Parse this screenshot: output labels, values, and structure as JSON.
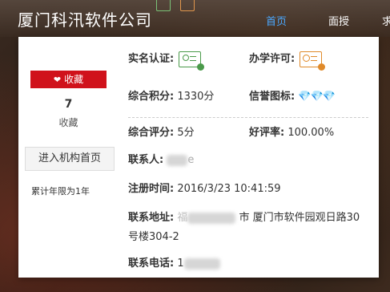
{
  "header": {
    "company_name": "厦门科汛软件公司",
    "nav": [
      {
        "label": "首页",
        "active": true
      },
      {
        "label": "面授",
        "active": false
      },
      {
        "label": "求",
        "active": false
      }
    ]
  },
  "sidebar": {
    "favorite_button": "收藏",
    "favorite_count": "7",
    "favorite_label": "收藏",
    "enter_button": "进入机构首页",
    "yearly_limit": "累计年限为1年"
  },
  "info": {
    "real_name_label": "实名认证:",
    "license_label": "办学许可:",
    "points_label": "综合积分:",
    "points_value": "1330分",
    "credit_label": "信誉图标:",
    "credit_diamonds": 3,
    "score_label": "综合评分:",
    "score_value": "5分",
    "praise_label": "好评率:",
    "praise_value": "100.00%",
    "contact_label": "联系人:",
    "contact_value_tail": "e",
    "register_label": "注册时间:",
    "register_value": "2016/3/23 10:41:59",
    "address_label": "联系地址:",
    "address_value_head": "福",
    "address_value_tail": "市 厦门市软件园观日路30",
    "address_value_line2": "号楼304-2",
    "phone_label": "联系电话:",
    "phone_value_head": "1"
  },
  "colors": {
    "favorite_red": "#d0121b",
    "nav_active": "#4aa8ff",
    "diamond": "#1fa9e8",
    "cert_green": "#4a9a4a",
    "cert_orange": "#e08a2a"
  }
}
